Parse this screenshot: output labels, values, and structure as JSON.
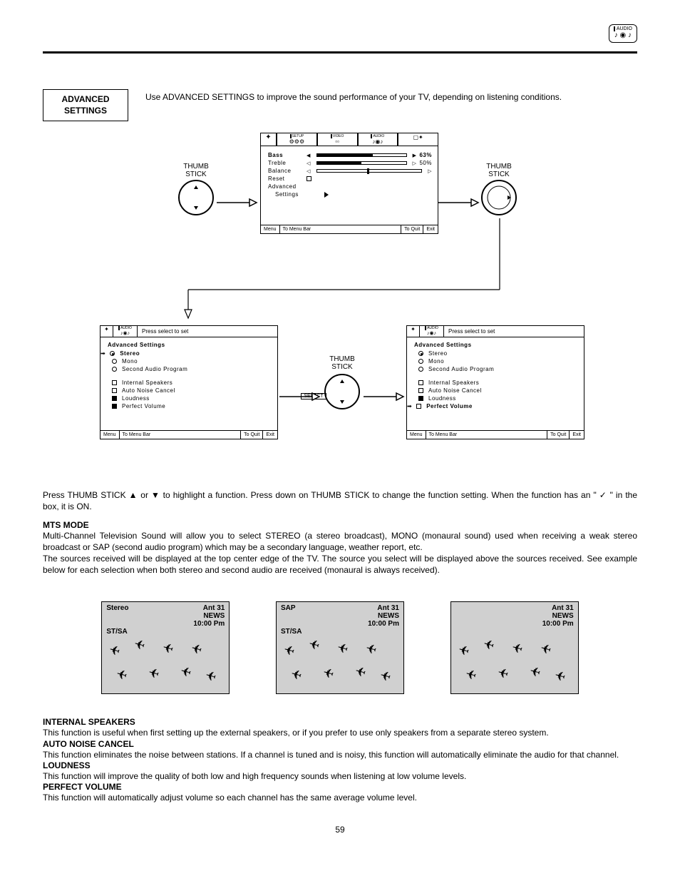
{
  "header_icon_label": "AUDIO",
  "section_box": {
    "line1": "ADVANCED",
    "line2": "SETTINGS"
  },
  "intro": "Use ADVANCED SETTINGS to improve the sound performance of your TV, depending on listening conditions.",
  "thumb_label": "THUMB\nSTICK",
  "select_label": "SELECT",
  "audio_menu": {
    "tabs": [
      "SETUP",
      "VIDEO",
      "AUDIO",
      ""
    ],
    "rows": [
      {
        "label": "Bass",
        "value": "63%",
        "bold": true
      },
      {
        "label": "Treble",
        "value": "50%"
      },
      {
        "label": "Balance",
        "center": true
      },
      {
        "label": "Reset",
        "check": true
      },
      {
        "label": "Advanced"
      },
      {
        "label": "Settings",
        "arrow": true,
        "indent": true
      }
    ],
    "footer": {
      "menu": "Menu",
      "menubar": "To Menu Bar",
      "toquit": "To Quit",
      "exit": "Exit"
    }
  },
  "adv_panel_header": {
    "icon": "AUDIO",
    "hint": "Press select to set"
  },
  "adv_panel_left": {
    "title": "Advanced Settings",
    "cursor_on": "Stereo",
    "radios": [
      {
        "label": "Stereo",
        "selected": true
      },
      {
        "label": "Mono",
        "selected": false
      },
      {
        "label": "Second Audio Program",
        "selected": false
      }
    ],
    "checks": [
      {
        "label": "Internal Speakers",
        "checked": false
      },
      {
        "label": "Auto Noise Cancel",
        "checked": false
      },
      {
        "label": "Loudness",
        "checked": true
      },
      {
        "label": "Perfect Volume",
        "checked": true
      }
    ]
  },
  "adv_panel_right": {
    "title": "Advanced Settings",
    "cursor_on": "Perfect Volume",
    "radios": [
      {
        "label": "Stereo",
        "selected": true
      },
      {
        "label": "Mono",
        "selected": false
      },
      {
        "label": "Second Audio Program",
        "selected": false
      }
    ],
    "checks": [
      {
        "label": "Internal Speakers",
        "checked": false
      },
      {
        "label": "Auto Noise Cancel",
        "checked": false
      },
      {
        "label": "Loudness",
        "checked": true
      },
      {
        "label": "Perfect Volume",
        "checked": false,
        "bold": true
      }
    ]
  },
  "instruction_line": "Press THUMB STICK ▲ or ▼ to highlight a function. Press down on THUMB STICK to change the function setting. When the function has an \" ✓ \" in the box, it is ON.",
  "mts": {
    "title": "MTS MODE",
    "p1": "Multi-Channel Television Sound will allow you to select STEREO (a stereo broadcast), MONO (monaural sound) used when receiving a weak stereo broadcast or SAP (second audio program) which may be a secondary language, weather report, etc.",
    "p2": "The sources received will be displayed at the top center edge of the TV.  The source you select will be displayed above the sources received.  See example below for each selection when both stereo and second audio are received (monaural is always received)."
  },
  "examples": [
    {
      "topl": "Stereo",
      "topr1": "Ant    31",
      "sub": "ST/SA",
      "r2": "NEWS",
      "r3": "10:00 Pm"
    },
    {
      "topl": "SAP",
      "topr1": "Ant    31",
      "sub": "ST/SA",
      "r2": "NEWS",
      "r3": "10:00 Pm"
    },
    {
      "topl": "",
      "topr1": "Ant    31",
      "sub": "",
      "r2": "NEWS",
      "r3": "10:00 Pm"
    }
  ],
  "sections": [
    {
      "title": "INTERNAL SPEAKERS",
      "body": "This function is useful when first setting up the external speakers, or if you prefer to use only speakers from a separate stereo system."
    },
    {
      "title": "AUTO NOISE CANCEL",
      "body": "This function eliminates the noise between stations. If a channel is tuned and is noisy, this function will automatically eliminate the audio for that channel."
    },
    {
      "title": "LOUDNESS",
      "body": "This function will improve the quality of both low and high frequency sounds when listening at low volume levels."
    },
    {
      "title": "PERFECT VOLUME",
      "body": "This function will automatically adjust volume so each channel has the same average volume level."
    }
  ],
  "page_number": "59"
}
